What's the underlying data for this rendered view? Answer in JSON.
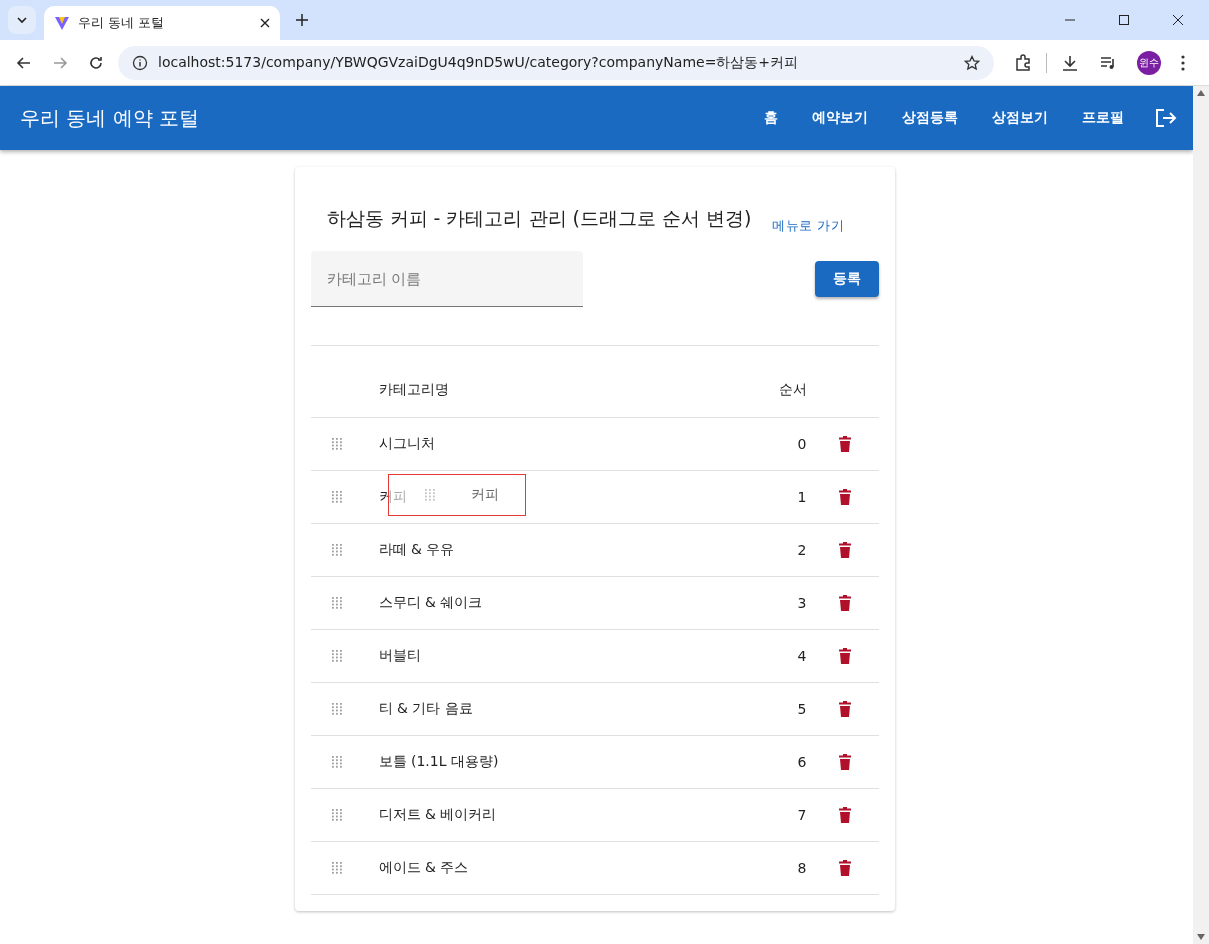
{
  "browser": {
    "tab_title": "우리 동네 포털",
    "url": "localhost:5173/company/YBWQGVzaiDgU4q9nD5wU/category?companyName=하삼동+커피",
    "avatar": "윈수"
  },
  "app_bar": {
    "title": "우리 동네 예약 포털",
    "nav": [
      "홈",
      "예약보기",
      "상점등록",
      "상점보기",
      "프로필"
    ]
  },
  "card": {
    "title": "하삼동 커피 - 카테고리 관리 (드래그로 순서 변경)",
    "menu_link": "메뉴로 가기",
    "name_field": {
      "placeholder": "카테고리 이름"
    },
    "register_button": "등록",
    "columns": [
      "카테고리명",
      "순서"
    ],
    "rows": [
      {
        "name": "시그니처",
        "order": "0"
      },
      {
        "name": "커피",
        "order": "1"
      },
      {
        "name": "라떼 & 우유",
        "order": "2"
      },
      {
        "name": "스무디 & 쉐이크",
        "order": "3"
      },
      {
        "name": "버블티",
        "order": "4"
      },
      {
        "name": "티 & 기타 음료",
        "order": "5"
      },
      {
        "name": "보틀 (1.1L 대용량)",
        "order": "6"
      },
      {
        "name": "디저트 & 베이커리",
        "order": "7"
      },
      {
        "name": "에이드 & 주스",
        "order": "8"
      }
    ],
    "drag_ghost": {
      "label": "커피"
    }
  }
}
